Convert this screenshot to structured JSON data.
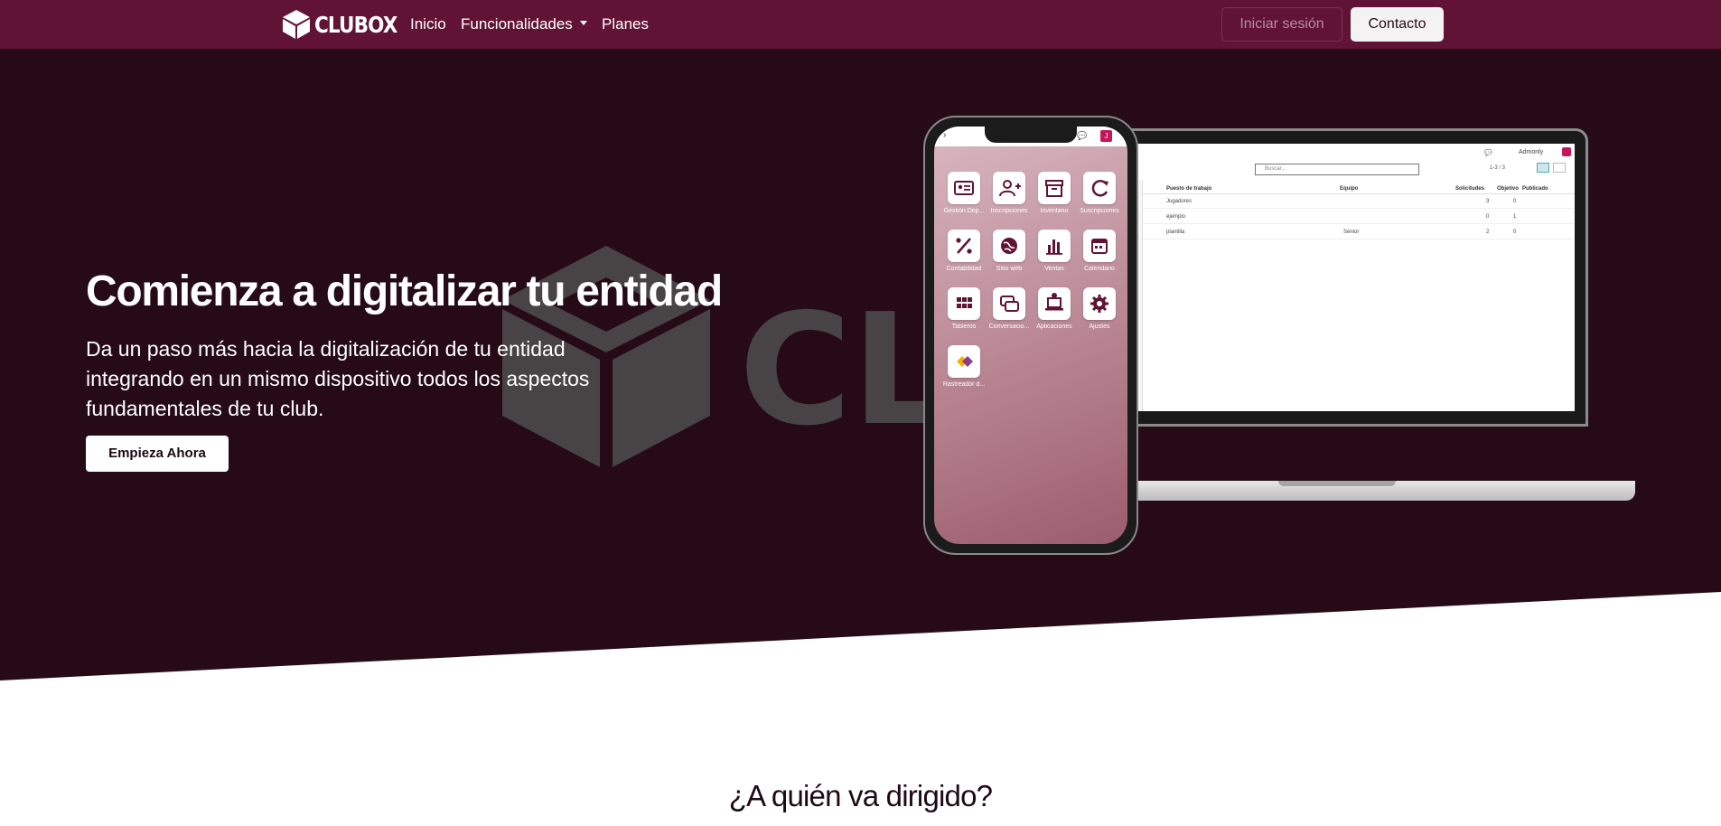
{
  "nav": {
    "brand": "CLUBOX",
    "links": [
      "Inicio",
      "Funcionalidades",
      "Planes"
    ],
    "login": "Iniciar sesión",
    "contact": "Contacto"
  },
  "hero": {
    "title": "Comienza a digitalizar tu entidad",
    "description": "Da un paso más hacia la digitalización de tu entidad integrando en un mismo dispositivo todos los aspectos fundamentales de tu club.",
    "cta": "Empieza Ahora",
    "watermark": "CLU"
  },
  "laptop": {
    "user": "Admonly",
    "search_placeholder": "Buscar...",
    "pager": "1-3 / 3",
    "columns": [
      "Puesto de trabajo",
      "Equipo",
      "Solicitudes",
      "Objetivo",
      "Publicado"
    ],
    "rows": [
      {
        "name": "Jugadores",
        "team": "",
        "requests": "3",
        "target": "0"
      },
      {
        "name": "ejemplo",
        "team": "",
        "requests": "0",
        "target": "1"
      },
      {
        "name": "plantilla",
        "team": "Sénior",
        "requests": "2",
        "target": "0"
      }
    ]
  },
  "phone": {
    "badge": "J",
    "apps": [
      {
        "label": "Gestión Dep...",
        "icon": "id-card-icon"
      },
      {
        "label": "Inscripciones",
        "icon": "user-plus-icon"
      },
      {
        "label": "Inventario",
        "icon": "archive-icon"
      },
      {
        "label": "Suscripciones",
        "icon": "refresh-icon"
      },
      {
        "label": "Contabilidad",
        "icon": "percent-icon"
      },
      {
        "label": "Sitio web",
        "icon": "globe-icon"
      },
      {
        "label": "Ventas",
        "icon": "bar-chart-icon"
      },
      {
        "label": "Calendario",
        "icon": "calendar-icon"
      },
      {
        "label": "Tableros",
        "icon": "grid-icon"
      },
      {
        "label": "Conversacio...",
        "icon": "chat-icon"
      },
      {
        "label": "Aplicaciones",
        "icon": "laptop-icon"
      },
      {
        "label": "Ajustes",
        "icon": "gear-icon"
      },
      {
        "label": "Rastreador d...",
        "icon": "tracker-icon"
      }
    ]
  },
  "section": {
    "title": "¿A quién va dirigido?"
  },
  "colors": {
    "navbar": "#611335",
    "hero_bg": "#260b17",
    "accent": "#611335"
  }
}
